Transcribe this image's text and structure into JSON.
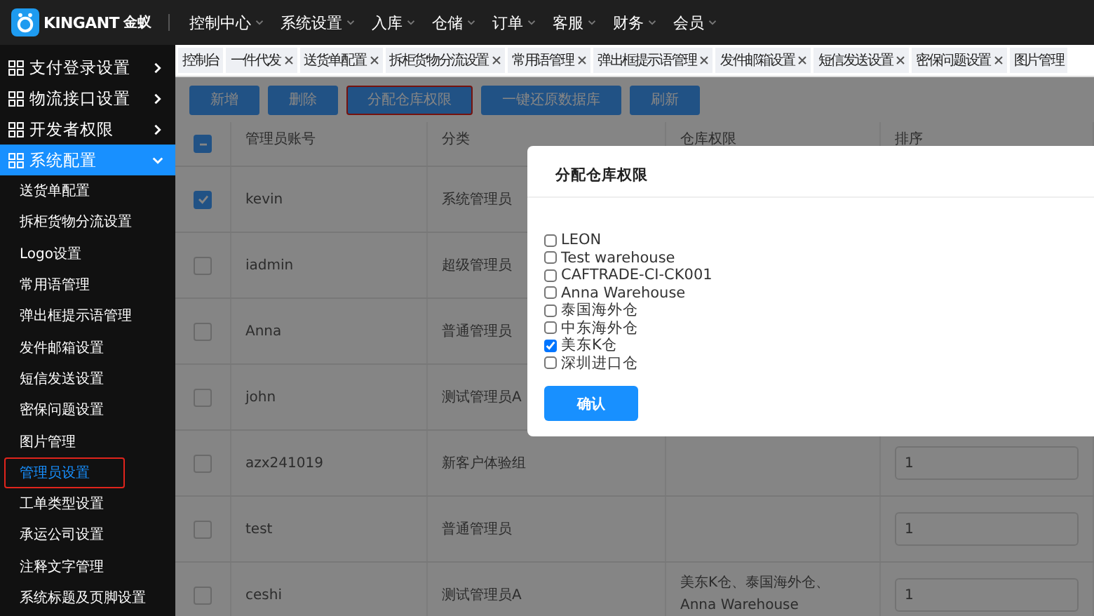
{
  "logo": {
    "brand": "KINGANT",
    "name": "金蚁"
  },
  "nav": [
    {
      "label": "控制中心"
    },
    {
      "label": "系统设置"
    },
    {
      "label": "入库"
    },
    {
      "label": "仓储"
    },
    {
      "label": "订单"
    },
    {
      "label": "客服"
    },
    {
      "label": "财务"
    },
    {
      "label": "会员"
    }
  ],
  "sidebar": {
    "groups": [
      {
        "label": "支付登录设置",
        "expanded": false,
        "selected": false
      },
      {
        "label": "物流接口设置",
        "expanded": false,
        "selected": false
      },
      {
        "label": "开发者权限",
        "expanded": false,
        "selected": false
      },
      {
        "label": "系统配置",
        "expanded": true,
        "selected": true,
        "children": [
          {
            "label": "送货单配置",
            "selected": false,
            "highlighted": false
          },
          {
            "label": "拆柜货物分流设置",
            "selected": false,
            "highlighted": false
          },
          {
            "label": "Logo设置",
            "selected": false,
            "highlighted": false
          },
          {
            "label": "常用语管理",
            "selected": false,
            "highlighted": false
          },
          {
            "label": "弹出框提示语管理",
            "selected": false,
            "highlighted": false
          },
          {
            "label": "发件邮箱设置",
            "selected": false,
            "highlighted": false
          },
          {
            "label": "短信发送设置",
            "selected": false,
            "highlighted": false
          },
          {
            "label": "密保问题设置",
            "selected": false,
            "highlighted": false
          },
          {
            "label": "图片管理",
            "selected": false,
            "highlighted": false
          },
          {
            "label": "管理员设置",
            "selected": true,
            "highlighted": true
          },
          {
            "label": "工单类型设置",
            "selected": false,
            "highlighted": false
          },
          {
            "label": "承运公司设置",
            "selected": false,
            "highlighted": false
          },
          {
            "label": "注释文字管理",
            "selected": false,
            "highlighted": false
          },
          {
            "label": "系统标题及页脚设置",
            "selected": false,
            "highlighted": false
          }
        ]
      }
    ]
  },
  "tabs": [
    {
      "label": "控制台",
      "closable": false
    },
    {
      "label": "一件代发",
      "closable": true
    },
    {
      "label": "送货单配置",
      "closable": true
    },
    {
      "label": "拆柜货物分流设置",
      "closable": true
    },
    {
      "label": "常用语管理",
      "closable": true
    },
    {
      "label": "弹出框提示语管理",
      "closable": true
    },
    {
      "label": "发件邮箱设置",
      "closable": true
    },
    {
      "label": "短信发送设置",
      "closable": true
    },
    {
      "label": "密保问题设置",
      "closable": true
    },
    {
      "label": "图片管理",
      "closable": false
    }
  ],
  "toolbar": [
    {
      "label": "新增",
      "highlighted": false
    },
    {
      "label": "删除",
      "highlighted": false
    },
    {
      "label": "分配仓库权限",
      "highlighted": true
    },
    {
      "label": "一键还原数据库",
      "highlighted": false
    },
    {
      "label": "刷新",
      "highlighted": false
    }
  ],
  "table": {
    "header_indeterminate": true,
    "columns": [
      "管理员账号",
      "分类",
      "仓库权限",
      "排序"
    ],
    "rows": [
      {
        "checked": true,
        "account": "kevin",
        "category": "系统管理员"
      },
      {
        "checked": false,
        "account": "iadmin",
        "category": "超级管理员"
      },
      {
        "checked": false,
        "account": "Anna",
        "category": "普通管理员"
      },
      {
        "checked": false,
        "account": "john",
        "category": "测试管理员A"
      },
      {
        "checked": false,
        "account": "azx241019",
        "category": "新客户体验组",
        "order": "1"
      },
      {
        "checked": false,
        "account": "test",
        "category": "普通管理员",
        "order": "1"
      },
      {
        "checked": false,
        "account": "ceshi",
        "category": "测试管理员A",
        "warehouses": "美东K仓、泰国海外仓、Anna Warehouse",
        "order": "1"
      }
    ]
  },
  "modal": {
    "title": "分配仓库权限",
    "options": [
      {
        "label": "LEON",
        "checked": false
      },
      {
        "label": "Test warehouse",
        "checked": false
      },
      {
        "label": "CAFTRADE-CI-CK001",
        "checked": false
      },
      {
        "label": "Anna Warehouse",
        "checked": false
      },
      {
        "label": "泰国海外仓",
        "checked": false
      },
      {
        "label": "中东海外仓",
        "checked": false
      },
      {
        "label": "美东K仓",
        "checked": true
      },
      {
        "label": "深圳进口仓",
        "checked": false
      }
    ],
    "confirm": "确认"
  }
}
